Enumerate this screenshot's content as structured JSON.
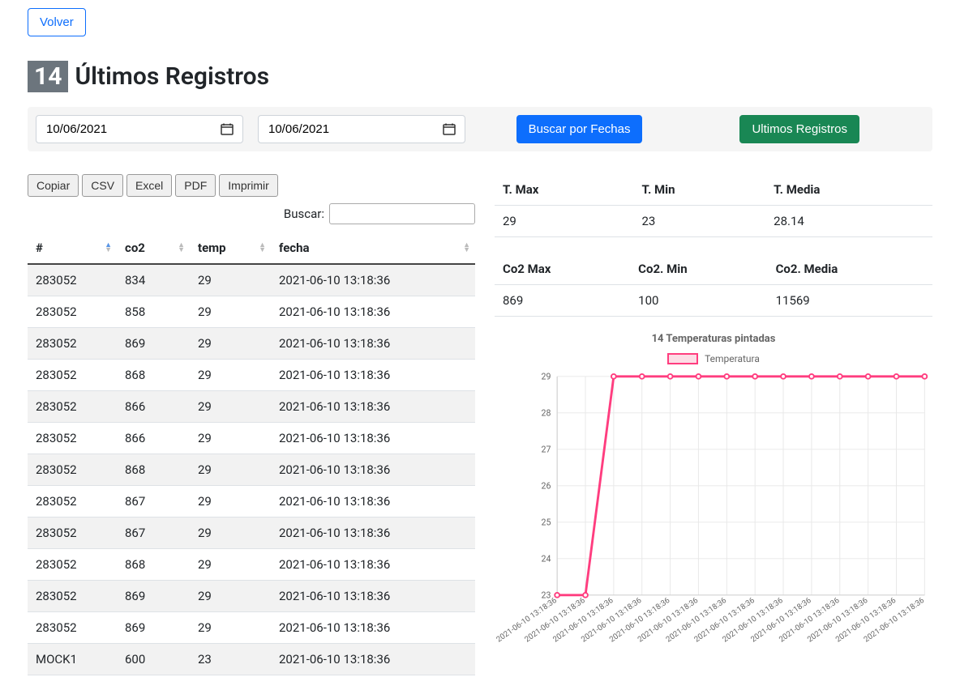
{
  "back_label": "Volver",
  "title_count": "14",
  "title_text": "Últimos Registros",
  "date_from": "10/06/2021",
  "date_to": "10/06/2021",
  "search_btn": "Buscar por Fechas",
  "latest_btn": "Ultimos Registros",
  "export": {
    "copy": "Copiar",
    "csv": "CSV",
    "excel": "Excel",
    "pdf": "PDF",
    "print": "Imprimir"
  },
  "search_label": "Buscar:",
  "columns": {
    "id": "#",
    "co2": "co2",
    "temp": "temp",
    "fecha": "fecha"
  },
  "rows": [
    {
      "id": "283052",
      "co2": "834",
      "temp": "29",
      "fecha": "2021-06-10 13:18:36"
    },
    {
      "id": "283052",
      "co2": "858",
      "temp": "29",
      "fecha": "2021-06-10 13:18:36"
    },
    {
      "id": "283052",
      "co2": "869",
      "temp": "29",
      "fecha": "2021-06-10 13:18:36"
    },
    {
      "id": "283052",
      "co2": "868",
      "temp": "29",
      "fecha": "2021-06-10 13:18:36"
    },
    {
      "id": "283052",
      "co2": "866",
      "temp": "29",
      "fecha": "2021-06-10 13:18:36"
    },
    {
      "id": "283052",
      "co2": "866",
      "temp": "29",
      "fecha": "2021-06-10 13:18:36"
    },
    {
      "id": "283052",
      "co2": "868",
      "temp": "29",
      "fecha": "2021-06-10 13:18:36"
    },
    {
      "id": "283052",
      "co2": "867",
      "temp": "29",
      "fecha": "2021-06-10 13:18:36"
    },
    {
      "id": "283052",
      "co2": "867",
      "temp": "29",
      "fecha": "2021-06-10 13:18:36"
    },
    {
      "id": "283052",
      "co2": "868",
      "temp": "29",
      "fecha": "2021-06-10 13:18:36"
    },
    {
      "id": "283052",
      "co2": "869",
      "temp": "29",
      "fecha": "2021-06-10 13:18:36"
    },
    {
      "id": "283052",
      "co2": "869",
      "temp": "29",
      "fecha": "2021-06-10 13:18:36"
    },
    {
      "id": "MOCK1",
      "co2": "600",
      "temp": "23",
      "fecha": "2021-06-10 13:18:36"
    }
  ],
  "stats_temp": {
    "h1": "T. Max",
    "h2": "T. Min",
    "h3": "T. Media",
    "v1": "29",
    "v2": "23",
    "v3": "28.14"
  },
  "stats_co2": {
    "h1": "Co2 Max",
    "h2": "Co2. Min",
    "h3": "Co2. Media",
    "v1": "869",
    "v2": "100",
    "v3": "11569"
  },
  "chart_title": "14 Temperaturas pintadas",
  "legend_label": "Temperatura",
  "chart_data": {
    "type": "line",
    "title": "14 Temperaturas pintadas",
    "ylabel": "",
    "xlabel": "",
    "ylim": [
      23,
      29
    ],
    "yticks": [
      23,
      24,
      25,
      26,
      27,
      28,
      29
    ],
    "categories": [
      "2021-06-10 13:18:36",
      "2021-06-10 13:18:36",
      "2021-06-10 13:18:36",
      "2021-06-10 13:18:36",
      "2021-06-10 13:18:36",
      "2021-06-10 13:18:36",
      "2021-06-10 13:18:36",
      "2021-06-10 13:18:36",
      "2021-06-10 13:18:36",
      "2021-06-10 13:18:36",
      "2021-06-10 13:18:36",
      "2021-06-10 13:18:36",
      "2021-06-10 13:18:36",
      "2021-06-10 13:18:36"
    ],
    "series": [
      {
        "name": "Temperatura",
        "color": "#ff3d7f",
        "values": [
          23,
          23,
          29,
          29,
          29,
          29,
          29,
          29,
          29,
          29,
          29,
          29,
          29,
          29
        ]
      }
    ]
  }
}
